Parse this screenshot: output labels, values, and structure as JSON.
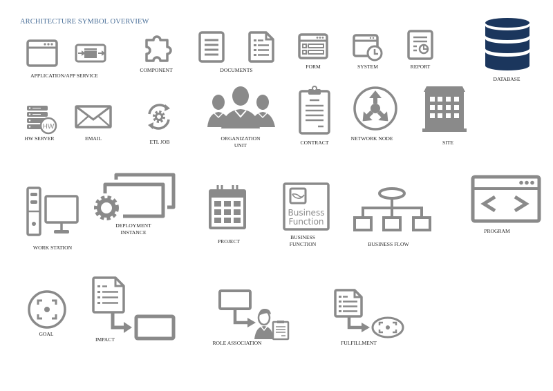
{
  "title": "ARCHITECTURE SYMBOL OVERVIEW",
  "colors": {
    "icon_gray": "#8a8a8a",
    "database_navy": "#1b365d",
    "title_blue": "#4a6f98"
  },
  "symbols": {
    "application": {
      "label": "APPLICATION/APP SERVICE",
      "icon": "browser-window-icon"
    },
    "component": {
      "label": "COMPONENT",
      "icon": "puzzle-piece-icon"
    },
    "documents": {
      "label": "DOCUMENTS",
      "icon": "document-icon"
    },
    "form": {
      "label": "FORM",
      "icon": "form-window-icon"
    },
    "system": {
      "label": "SYSTEM",
      "icon": "window-clock-icon"
    },
    "report": {
      "label": "REPORT",
      "icon": "report-chart-icon"
    },
    "database": {
      "label": "DATABASE",
      "icon": "database-cylinder-icon"
    },
    "hw_server": {
      "label": "HW SERVER",
      "icon": "server-stack-icon",
      "badge": "HW"
    },
    "email": {
      "label": "EMAIL",
      "icon": "envelope-icon"
    },
    "etl_job": {
      "label": "ETL JOB",
      "icon": "gear-cycle-icon"
    },
    "organization_unit": {
      "label_line1": "ORGANIZATION",
      "label_line2": "UNIT",
      "icon": "people-group-icon"
    },
    "contract": {
      "label": "CONTRACT",
      "icon": "clipboard-icon"
    },
    "network_node": {
      "label": "NETWORK NODE",
      "icon": "network-node-icon"
    },
    "site": {
      "label": "SITE",
      "icon": "building-icon"
    },
    "work_station": {
      "label": "WORK STATION",
      "icon": "desktop-computer-icon"
    },
    "deployment_instance": {
      "label_line1": "DEPLOYMENT",
      "label_line2": "INSTANCE",
      "icon": "gear-windows-icon"
    },
    "project": {
      "label": "PROJECT",
      "icon": "calendar-icon"
    },
    "business_function": {
      "label_line1": "BUSINESS",
      "label_line2": "FUNCTION",
      "icon": "business-function-icon",
      "icon_text_line1": "Business",
      "icon_text_line2": "Function"
    },
    "business_flow": {
      "label": "BUSINESS FLOW",
      "icon": "hierarchy-flow-icon"
    },
    "program": {
      "label": "PROGRAM",
      "icon": "code-window-icon"
    },
    "goal": {
      "label": "GOAL",
      "icon": "target-focus-icon"
    },
    "impact": {
      "label": "IMPACT",
      "icon": "document-arrow-box-icon"
    },
    "role_association": {
      "label": "ROLE ASSOCIATION",
      "icon": "box-arrow-person-icon"
    },
    "fulfillment": {
      "label": "FULFILLMENT",
      "icon": "document-arrow-goal-icon"
    }
  }
}
